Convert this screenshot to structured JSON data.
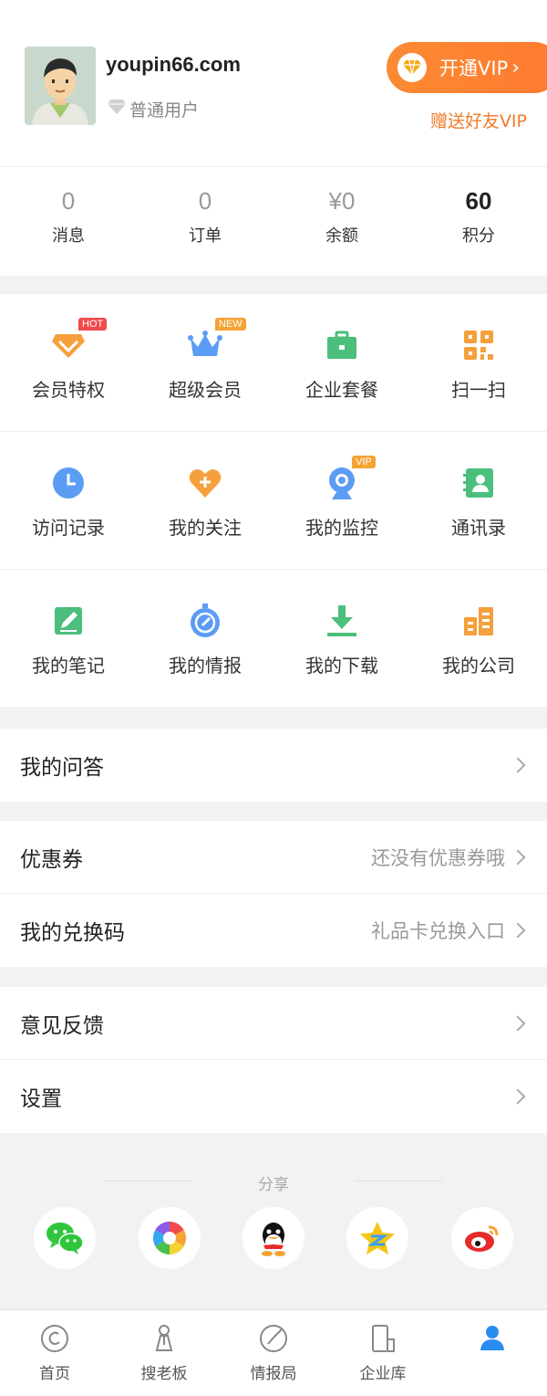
{
  "profile": {
    "username": "youpin66.com",
    "level": "普通用户",
    "vip_button": "开通VIP",
    "gift_vip": "赠送好友VIP"
  },
  "stats": [
    {
      "value": "0",
      "label": "消息"
    },
    {
      "value": "0",
      "label": "订单"
    },
    {
      "value": "¥0",
      "label": "余额"
    },
    {
      "value": "60",
      "label": "积分"
    }
  ],
  "grid": {
    "row1": [
      {
        "label": "会员特权",
        "icon": "diamond-icon",
        "badge": "HOT"
      },
      {
        "label": "超级会员",
        "icon": "crown-icon",
        "badge": "NEW"
      },
      {
        "label": "企业套餐",
        "icon": "briefcase-icon"
      },
      {
        "label": "扫一扫",
        "icon": "qr-icon"
      }
    ],
    "row2": [
      {
        "label": "访问记录",
        "icon": "clock-icon"
      },
      {
        "label": "我的关注",
        "icon": "heart-plus-icon"
      },
      {
        "label": "我的监控",
        "icon": "camera-icon",
        "badge": "VIP"
      },
      {
        "label": "通讯录",
        "icon": "contacts-icon"
      }
    ],
    "row3": [
      {
        "label": "我的笔记",
        "icon": "note-icon"
      },
      {
        "label": "我的情报",
        "icon": "compass-icon"
      },
      {
        "label": "我的下载",
        "icon": "download-icon"
      },
      {
        "label": "我的公司",
        "icon": "buildings-icon"
      }
    ]
  },
  "lists": {
    "qa": {
      "title": "我的问答"
    },
    "coupon": {
      "title": "优惠券",
      "hint": "还没有优惠券哦"
    },
    "redeem": {
      "title": "我的兑换码",
      "hint": "礼品卡兑换入口"
    },
    "feedback": {
      "title": "意见反馈"
    },
    "settings": {
      "title": "设置"
    }
  },
  "share": {
    "title": "分享",
    "targets": [
      "wechat-icon",
      "moments-icon",
      "qq-icon",
      "qzone-icon",
      "weibo-icon"
    ]
  },
  "tabs": [
    {
      "label": "首页",
      "icon": "home-icon"
    },
    {
      "label": "搜老板",
      "icon": "boss-icon"
    },
    {
      "label": "情报局",
      "icon": "intel-icon"
    },
    {
      "label": "企业库",
      "icon": "company-icon"
    },
    {
      "label": "",
      "icon": "profile-icon",
      "active": true
    }
  ],
  "colors": {
    "accent": "#ff7a30",
    "active_tab": "#2a8cf0"
  }
}
